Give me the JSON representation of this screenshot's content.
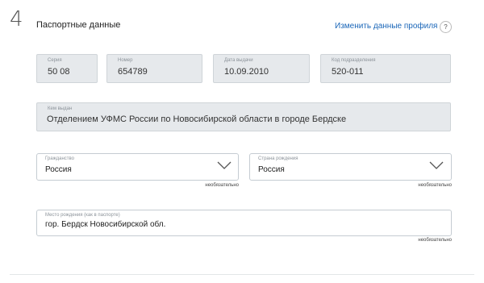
{
  "step": {
    "number": "4",
    "title": "Паспортные данные"
  },
  "profile_link": "Изменить данные профиля",
  "help_icon": "?",
  "passport": {
    "series": {
      "label": "Серия",
      "value": "50 08"
    },
    "number": {
      "label": "Номер",
      "value": "654789"
    },
    "issue_date": {
      "label": "Дата выдачи",
      "value": "10.09.2010"
    },
    "division_code": {
      "label": "Код подразделения",
      "value": "520-011"
    },
    "issued_by": {
      "label": "Кем выдан",
      "value": "Отделением УФМС России по Новосибирской области в городе Бердске"
    }
  },
  "citizenship": {
    "label": "Гражданство",
    "value": "Россия",
    "note": "необязательно"
  },
  "birth_country": {
    "label": "Страна рождения",
    "value": "Россия",
    "note": "необязательно"
  },
  "birth_place": {
    "label": "Место рождения (как в паспорте)",
    "value": "гор. Бердск Новосибирской обл.",
    "note": "необязательно"
  },
  "icons": {
    "help": "help-icon",
    "dropdown": "chevron-down-icon"
  }
}
